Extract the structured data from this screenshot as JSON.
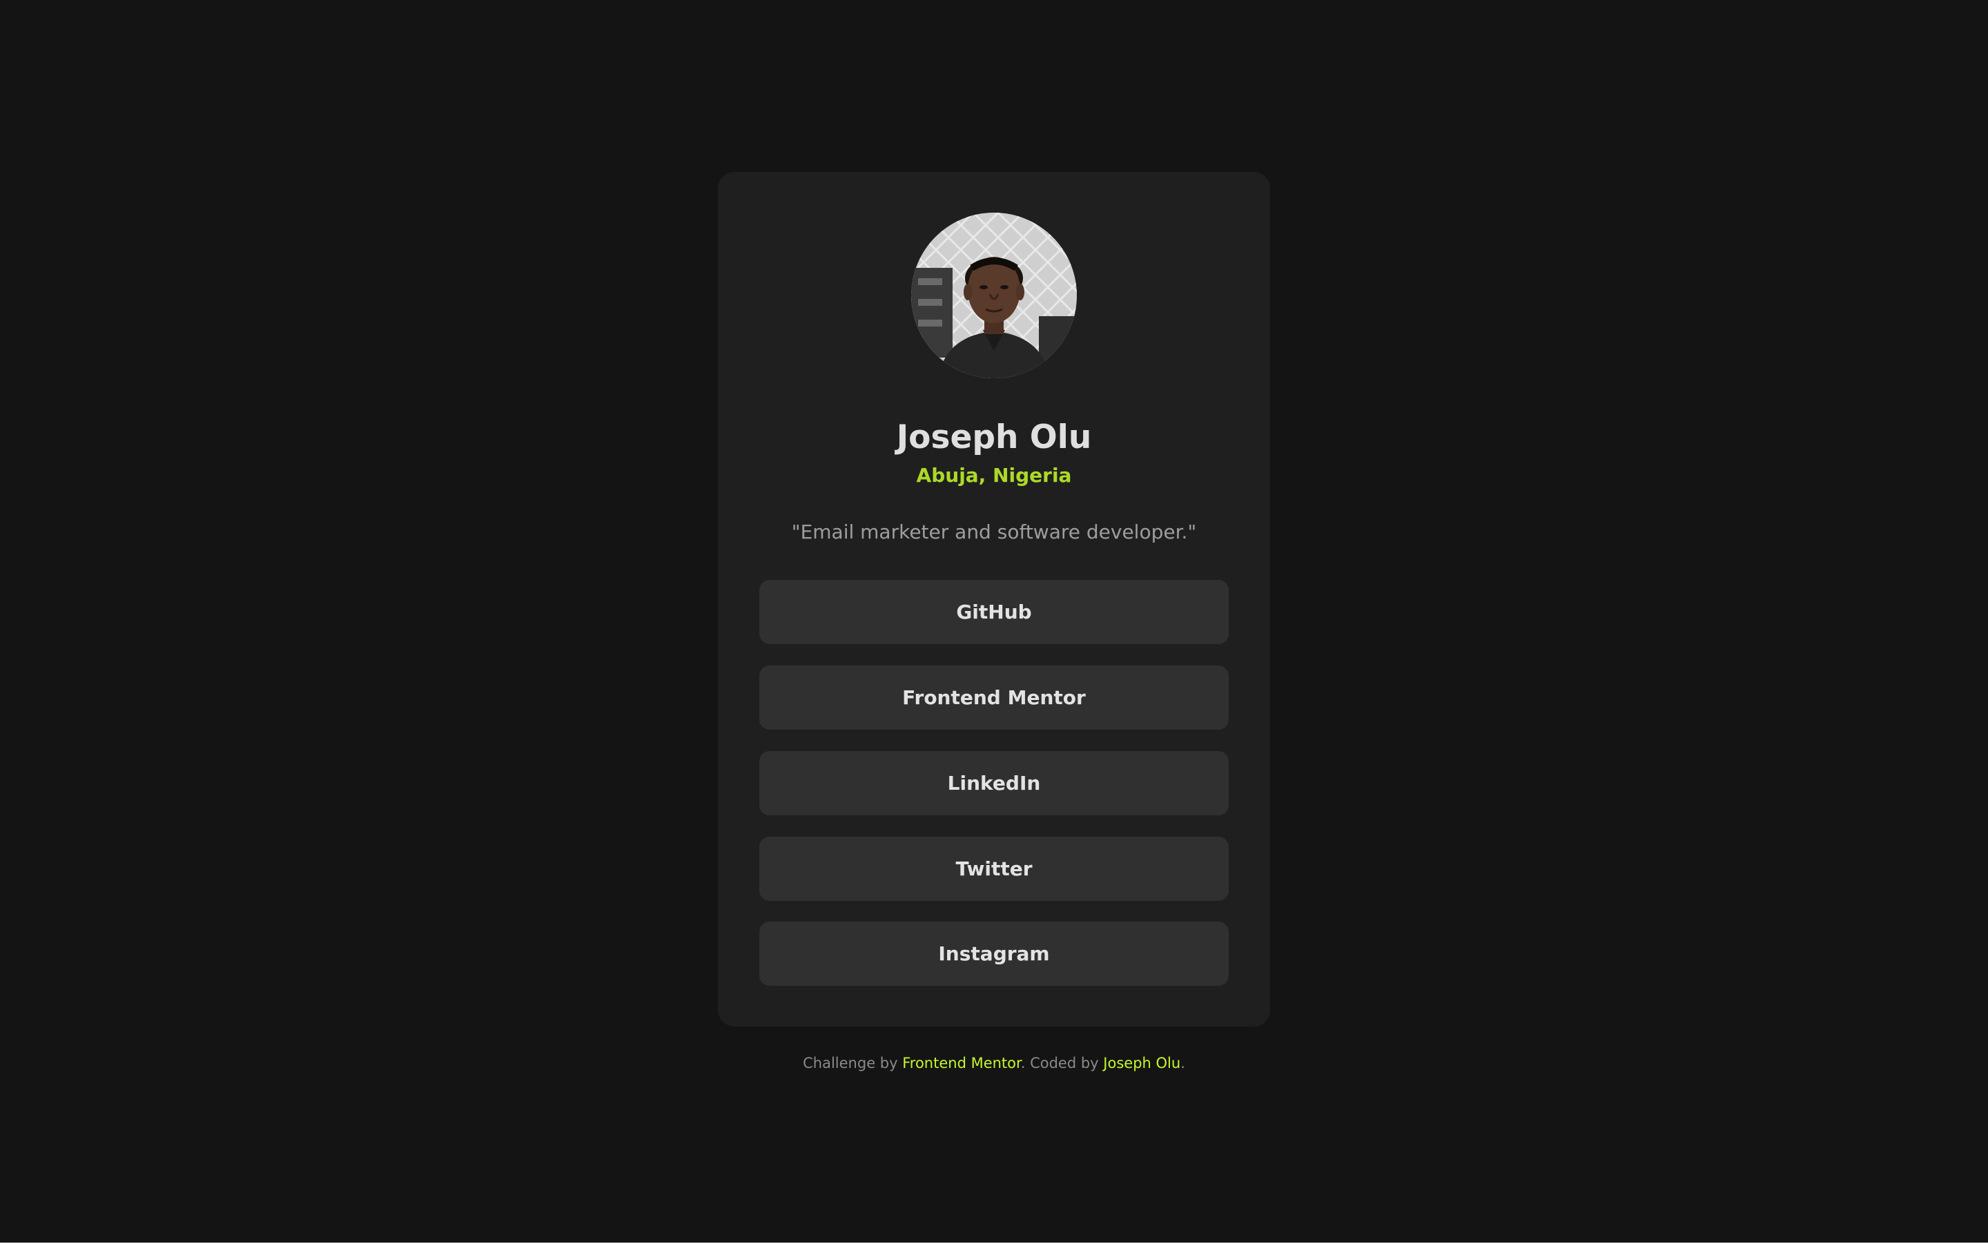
{
  "profile": {
    "name": "Joseph Olu",
    "location": "Abuja, Nigeria",
    "bio": "\"Email marketer and software developer.\""
  },
  "links": [
    {
      "label": "GitHub"
    },
    {
      "label": "Frontend Mentor"
    },
    {
      "label": "LinkedIn"
    },
    {
      "label": "Twitter"
    },
    {
      "label": "Instagram"
    }
  ],
  "footer": {
    "prefix": "Challenge by ",
    "challenge_link": "Frontend Mentor",
    "middle": ". Coded by ",
    "author_link": "Joseph Olu",
    "suffix": "."
  },
  "colors": {
    "page_background": "#141414",
    "card_background": "#1f1f1f",
    "button_background": "#333333",
    "accent_green": "#c4f82a",
    "text_white": "#ffffff",
    "text_grey": "#8a8a8a"
  },
  "icons": {
    "avatar": "profile-photo"
  }
}
